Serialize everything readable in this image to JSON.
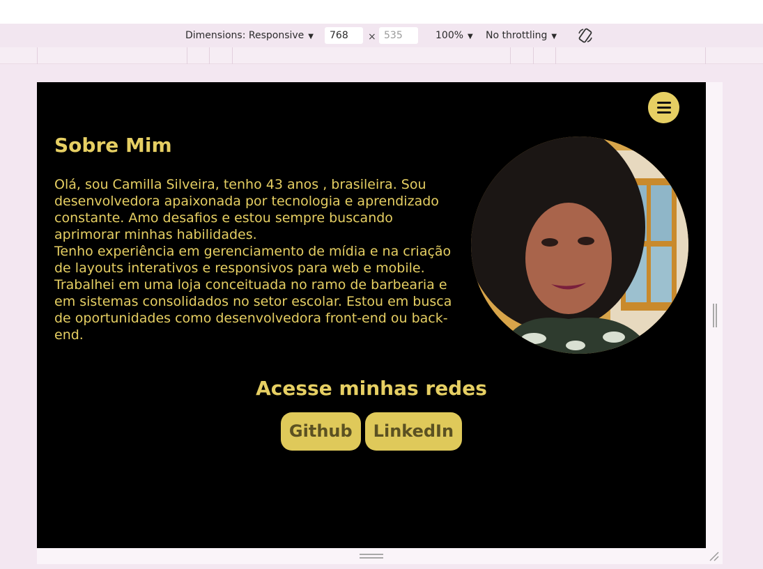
{
  "devtools_toolbar": {
    "dimensions_label": "Dimensions: Responsive",
    "width_value": "768",
    "times_symbol": "×",
    "height_placeholder": "535",
    "zoom_label": "100%",
    "throttling_label": "No throttling",
    "caret": "▼",
    "rotate_icon": "rotate-icon"
  },
  "page": {
    "menu_icon": "hamburger-menu-icon",
    "about_title": "Sobre Mim",
    "about_paragraph_1": "Olá, sou Camilla Silveira, tenho 43 anos , brasileira. Sou desenvolvedora apaixonada por tecnologia e aprendizado constante. Amo desafios e estou sempre buscando aprimorar minhas habilidades.",
    "about_paragraph_2": "Tenho experiência em gerenciamento de mídia e na criação de layouts interativos e responsivos para web e mobile. Trabalhei em uma loja conceituada no ramo de barbearia e em sistemas consolidados no setor escolar. Estou em busca de oportunidades como desenvolvedora front-end ou back-end.",
    "social_title": "Acesse minhas redes",
    "github_label": "Github",
    "linkedin_label": "LinkedIn"
  },
  "colors": {
    "accent": "#e6cf63",
    "background": "#000000",
    "devtools_bg": "#f2e6f0"
  }
}
